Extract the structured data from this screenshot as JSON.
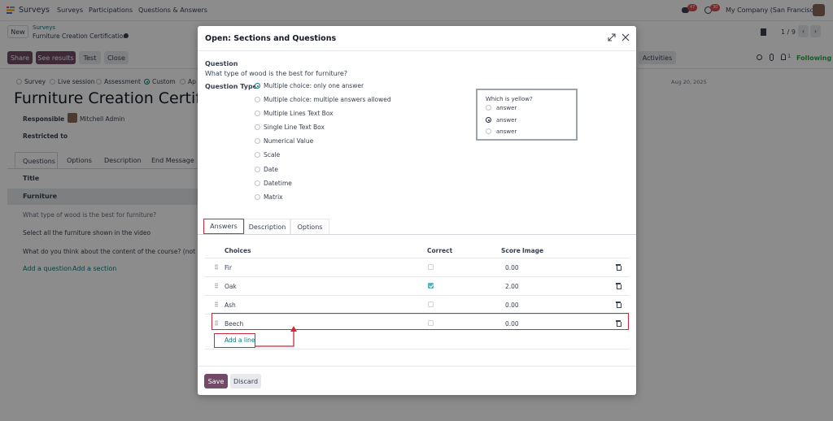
{
  "topnav": {
    "app_name": "Surveys",
    "menu": [
      "Surveys",
      "Participations",
      "Questions & Answers"
    ],
    "chat_count": "47",
    "activity_count": "30",
    "company": "My Company (San Francisco)"
  },
  "background": {
    "new_label": "New",
    "breadcrumb_parent": "Surveys",
    "breadcrumb_current": "Furniture Creation Certification",
    "pager": "1 / 9",
    "buttons": [
      "Share",
      "See results",
      "Test",
      "Close"
    ],
    "activities_label": "Activities",
    "follower_count": "1",
    "following_label": "Following",
    "survey_types": [
      "Survey",
      "Live session",
      "Assessment",
      "Custom",
      "Ap"
    ],
    "date": "Aug 20, 2025",
    "title": "Furniture Creation Certific",
    "responsible_label": "Responsible",
    "responsible_value": "Mitchell Admin",
    "restricted_label": "Restricted to",
    "tabs": [
      "Questions",
      "Options",
      "Description",
      "End Message"
    ],
    "table_header": "Title",
    "rows": [
      "Furniture",
      "What type of wood is the best for furniture?",
      "Select all the furniture shown in the video",
      "What do you think about the content of the course? (not rate"
    ],
    "add_question": "Add a question",
    "add_section": "Add a section"
  },
  "modal": {
    "title": "Open: Sections and Questions",
    "question_label": "Question",
    "question_text": "What type of wood is the best for furniture?",
    "question_type_label": "Question Type",
    "question_types": [
      "Multiple choice: only one answer",
      "Multiple choice: multiple answers allowed",
      "Multiple Lines Text Box",
      "Single Line Text Box",
      "Numerical Value",
      "Scale",
      "Date",
      "Datetime",
      "Matrix"
    ],
    "selected_type_index": 0,
    "preview": {
      "title": "Which is yellow?",
      "options": [
        "answer",
        "answer",
        "answer"
      ],
      "selected_index": 1
    },
    "tabs": [
      "Answers",
      "Description",
      "Options"
    ],
    "active_tab": "Answers",
    "columns": {
      "choices": "Choices",
      "correct": "Correct",
      "score": "Score",
      "image": "Image"
    },
    "answers": [
      {
        "choice": "Fir",
        "correct": false,
        "score": "0.00"
      },
      {
        "choice": "Oak",
        "correct": true,
        "score": "2.00"
      },
      {
        "choice": "Ash",
        "correct": false,
        "score": "0.00"
      },
      {
        "choice": "Beech",
        "correct": false,
        "score": "0.00"
      }
    ],
    "add_line": "Add a line",
    "save_label": "Save",
    "discard_label": "Discard"
  },
  "colors": {
    "primary": "#714b67",
    "teal": "#017e84",
    "highlight": "#d0283a",
    "badge": "#e04c4c"
  }
}
